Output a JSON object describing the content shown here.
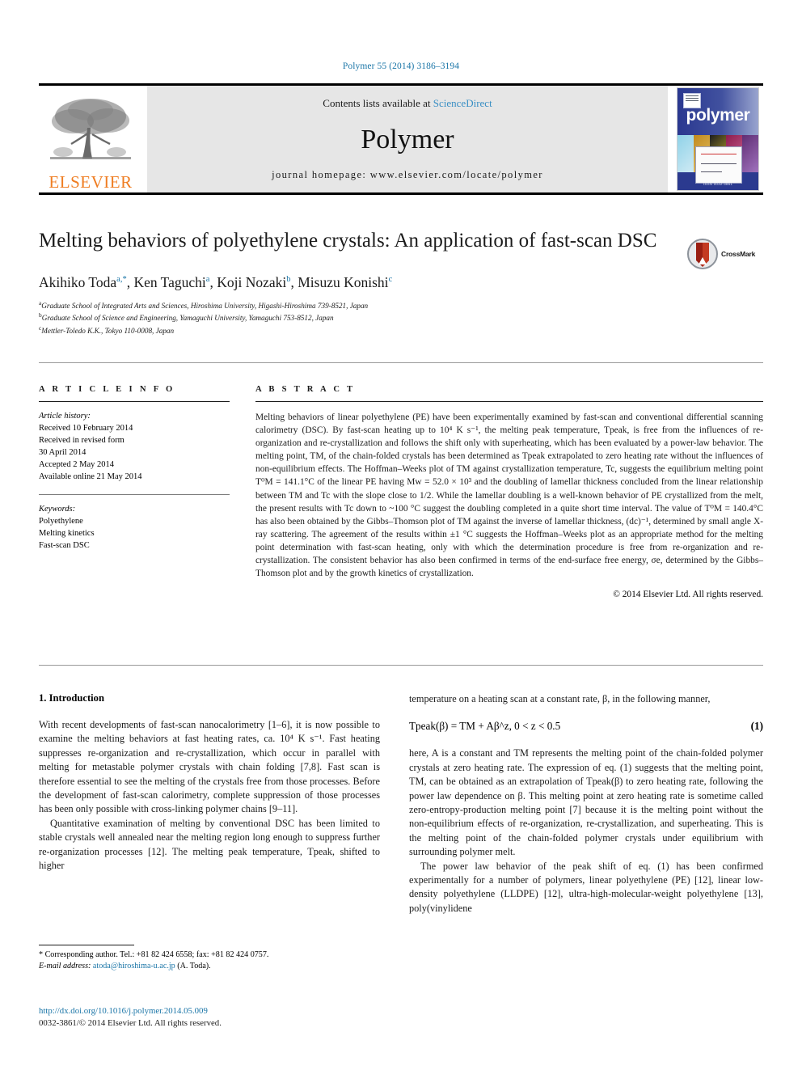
{
  "running_head": "Polymer 55 (2014) 3186–3194",
  "masthead": {
    "contents_prefix": "Contents lists available at ",
    "sciencedirect": "ScienceDirect",
    "journal_name": "Polymer",
    "homepage": "journal homepage: www.elsevier.com/locate/polymer",
    "publisher_logo_text": "ELSEVIER",
    "cover_title": "polymer",
    "cover_footer": "ISSN 0032-3861",
    "brand_orange": "#ef7d22",
    "brand_blue": "#1a75a7",
    "cover_navy": "#2b3a8f"
  },
  "article": {
    "title": "Melting behaviors of polyethylene crystals: An application of fast-scan DSC",
    "authors": [
      {
        "name": "Akihiko Toda",
        "marks": "a,*"
      },
      {
        "name": "Ken Taguchi",
        "marks": "a"
      },
      {
        "name": "Koji Nozaki",
        "marks": "b"
      },
      {
        "name": "Misuzu Konishi",
        "marks": "c"
      }
    ],
    "affiliations": [
      {
        "mark": "a",
        "text": "Graduate School of Integrated Arts and Sciences, Hiroshima University, Higashi-Hiroshima 739-8521, Japan"
      },
      {
        "mark": "b",
        "text": "Graduate School of Science and Engineering, Yamaguchi University, Yamaguchi 753-8512, Japan"
      },
      {
        "mark": "c",
        "text": "Mettler-Toledo K.K., Tokyo 110-0008, Japan"
      }
    ],
    "crossmark_label": "CrossMark"
  },
  "article_info": {
    "heading": "A R T I C L E  I N F O",
    "history_label": "Article history:",
    "history": [
      "Received 10 February 2014",
      "Received in revised form",
      "30 April 2014",
      "Accepted 2 May 2014",
      "Available online 21 May 2014"
    ],
    "keywords_label": "Keywords:",
    "keywords": [
      "Polyethylene",
      "Melting kinetics",
      "Fast-scan DSC"
    ]
  },
  "abstract": {
    "heading": "A B S T R A C T",
    "paragraphs": [
      "Melting behaviors of linear polyethylene (PE) have been experimentally examined by fast-scan and conventional differential scanning calorimetry (DSC). By fast-scan heating up to 10⁴ K s⁻¹, the melting peak temperature, Tpeak, is free from the influences of re-organization and re-crystallization and follows the shift only with superheating, which has been evaluated by a power-law behavior. The melting point, TM, of the chain-folded crystals has been determined as Tpeak extrapolated to zero heating rate without the influences of non-equilibrium effects. The Hoffman–Weeks plot of TM against crystallization temperature, Tc, suggests the equilibrium melting point T⁰M = 141.1°C of the linear PE having Mw = 52.0 × 10³ and the doubling of lamellar thickness concluded from the linear relationship between TM and Tc with the slope close to 1/2. While the lamellar doubling is a well-known behavior of PE crystallized from the melt, the present results with Tc down to ~100 °C suggest the doubling completed in a quite short time interval. The value of T⁰M = 140.4°C has also been obtained by the Gibbs–Thomson plot of TM against the inverse of lamellar thickness, (dc)⁻¹, determined by small angle X-ray scattering. The agreement of the results within ±1 °C suggests the Hoffman–Weeks plot as an appropriate method for the melting point determination with fast-scan heating, only with which the determination procedure is free from re-organization and re-crystallization. The consistent behavior has also been confirmed in terms of the end-surface free energy, σe, determined by the Gibbs–Thomson plot and by the growth kinetics of crystallization."
    ],
    "copyright": "© 2014 Elsevier Ltd. All rights reserved."
  },
  "introduction": {
    "heading": "1. Introduction",
    "left_paragraphs": [
      "With recent developments of fast-scan nanocalorimetry [1–6], it is now possible to examine the melting behaviors at fast heating rates, ca. 10⁴ K s⁻¹. Fast heating suppresses re-organization and re-crystallization, which occur in parallel with melting for metastable polymer crystals with chain folding [7,8]. Fast scan is therefore essential to see the melting of the crystals free from those processes. Before the development of fast-scan calorimetry, complete suppression of those processes has been only possible with cross-linking polymer chains [9–11].",
      "Quantitative examination of melting by conventional DSC has been limited to stable crystals well annealed near the melting region long enough to suppress further re-organization processes [12]. The melting peak temperature, Tpeak, shifted to higher"
    ],
    "right_intro": "temperature on a heating scan at a constant rate, β, in the following manner,",
    "equation": {
      "body": "Tpeak(β) = TM + Aβ^z, 0 < z < 0.5",
      "number": "(1)"
    },
    "right_paragraphs": [
      "here, A is a constant and TM represents the melting point of the chain-folded polymer crystals at zero heating rate. The expression of eq. (1) suggests that the melting point, TM, can be obtained as an extrapolation of Tpeak(β) to zero heating rate, following the power law dependence on β. This melting point at zero heating rate is sometime called zero-entropy-production melting point [7] because it is the melting point without the non-equilibrium effects of re-organization, re-crystallization, and superheating. This is the melting point of the chain-folded polymer crystals under equilibrium with surrounding polymer melt.",
      "The power law behavior of the peak shift of eq. (1) has been confirmed experimentally for a number of polymers, linear polyethylene (PE) [12], linear low-density polyethylene (LLDPE) [12], ultra-high-molecular-weight polyethylene [13], poly(vinylidene"
    ]
  },
  "footnote": {
    "corresponding": "* Corresponding author. Tel.: +81 82 424 6558; fax: +81 82 424 0757.",
    "email_label": "E-mail address:",
    "email": "atoda@hiroshima-u.ac.jp",
    "email_suffix": "(A. Toda)."
  },
  "footer": {
    "doi": "http://dx.doi.org/10.1016/j.polymer.2014.05.009",
    "issn": "0032-3861/© 2014 Elsevier Ltd. All rights reserved."
  }
}
